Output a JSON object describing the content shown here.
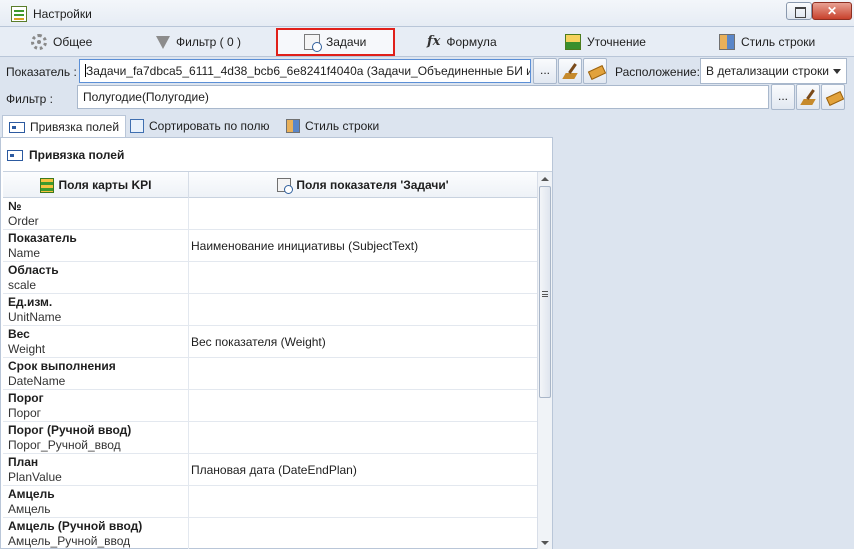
{
  "window": {
    "title": "Настройки"
  },
  "tabs": [
    {
      "label": "Общее",
      "icon": "gear-icon"
    },
    {
      "label": "Фильтр ( 0 )",
      "icon": "funnel-icon"
    },
    {
      "label": "Задачи",
      "icon": "task-icon",
      "active": true
    },
    {
      "label": "Формула",
      "icon": "fx-icon",
      "glyph": "fx"
    },
    {
      "label": "Уточнение",
      "icon": "refine-icon"
    },
    {
      "label": "Стиль строки",
      "icon": "row-style-icon"
    }
  ],
  "indicator": {
    "label": "Показатель :",
    "value": "Задачи_fa7dbca5_6111_4d38_bcb6_6e8241f4040a (Задачи_Объединенные БИ и О",
    "browse_label": "..."
  },
  "placement": {
    "label": "Расположение:",
    "value": "В детализации строки"
  },
  "filter": {
    "label": "Фильтр :",
    "value": "Полугодие(Полугодие)",
    "browse_label": "..."
  },
  "subtabs": [
    {
      "label": "Привязка полей",
      "icon": "binding-icon",
      "active": true
    },
    {
      "label": "Сортировать по полю",
      "icon": "sort-icon"
    },
    {
      "label": "Стиль строки",
      "icon": "row-style-icon"
    }
  ],
  "section_title": "Привязка полей",
  "grid": {
    "columns": [
      "Поля карты KPI",
      "Поля показателя 'Задачи'"
    ],
    "rows": [
      {
        "name": "№",
        "code": "Order",
        "value": ""
      },
      {
        "name": "Показатель",
        "code": "Name",
        "value": "Наименование инициативы (SubjectText)"
      },
      {
        "name": "Область",
        "code": "scale",
        "value": ""
      },
      {
        "name": "Ед.изм.",
        "code": "UnitName",
        "value": ""
      },
      {
        "name": "Вес",
        "code": "Weight",
        "value": "Вес показателя (Weight)"
      },
      {
        "name": "Срок выполнения",
        "code": "DateName",
        "value": ""
      },
      {
        "name": "Порог",
        "code": "Порог",
        "value": ""
      },
      {
        "name": "Порог (Ручной ввод)",
        "code": "Порог_Ручной_ввод",
        "value": ""
      },
      {
        "name": "План",
        "code": "PlanValue",
        "value": "Плановая дата (DateEndPlan)"
      },
      {
        "name": "Амцель",
        "code": "Амцель",
        "value": ""
      },
      {
        "name": "Амцель (Ручной ввод)",
        "code": "Амцель_Ручной_ввод",
        "value": ""
      }
    ]
  }
}
